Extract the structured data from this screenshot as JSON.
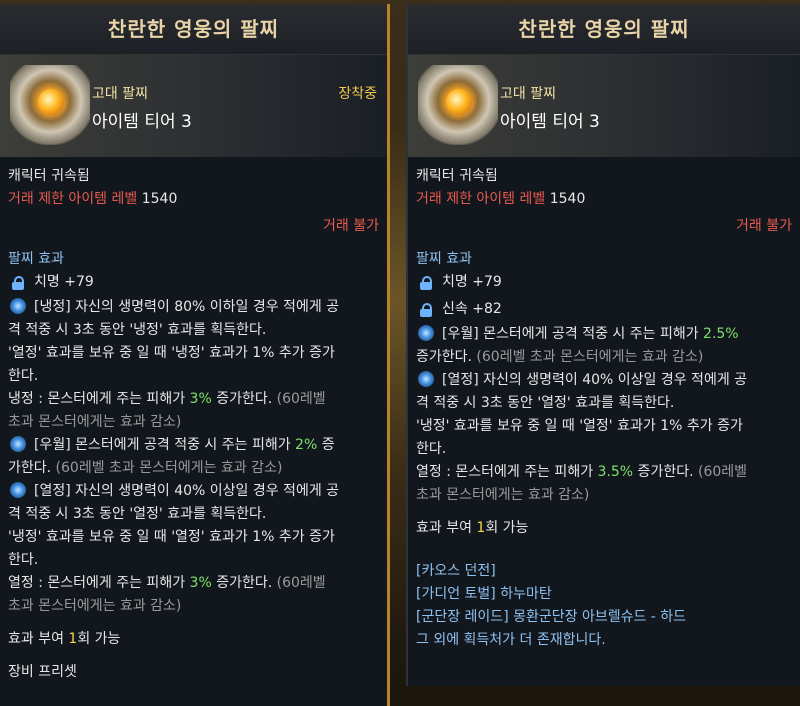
{
  "left": {
    "title": "찬란한 영웅의 팔찌",
    "item_type": "고대 팔찌",
    "tier": "아이템 티어 3",
    "equipped": "장착중",
    "bound": "캐릭터 귀속됨",
    "trade_level_label": "거래 제한 아이템 레벨",
    "trade_level_value": "1540",
    "trade_status": "거래 불가",
    "effects_header": "팔찌 효과",
    "stat1": "치명 +79",
    "e1_l1": "[냉정] 자신의 생명력이 80% 이하일 경우 적에게 공",
    "e1_l2": "격 적중 시 3초 동안 '냉정' 효과를 획득한다.",
    "e1_l3": "'열정' 효과를 보유 중 일 때 '냉정' 효과가 1% 추가 증가",
    "e1_l4": "한다.",
    "e1_l5a": "냉정 : 몬스터에게 주는 피해가 ",
    "e1_l5b": "3%",
    "e1_l5c": " 증가한다. ",
    "e1_l5d": "(60레벨",
    "e1_l6": "초과 몬스터에게는 효과 감소)",
    "e2_l1a": "[우월] 몬스터에게 공격 적중 시 주는 피해가 ",
    "e2_l1b": "2%",
    "e2_l1c": " 증",
    "e2_l2a": "가한다. ",
    "e2_l2b": "(60레벨 초과 몬스터에게는 효과 감소)",
    "e3_l1": "[열정] 자신의 생명력이 40% 이상일 경우 적에게 공",
    "e3_l2": "격 적중 시 3초 동안 '열정' 효과를 획득한다.",
    "e3_l3": "'냉정' 효과를 보유 중 일 때 '열정' 효과가 1% 추가 증가",
    "e3_l4": "한다.",
    "e3_l5a": "열정 : 몬스터에게 주는 피해가 ",
    "e3_l5b": "3%",
    "e3_l5c": " 증가한다. ",
    "e3_l5d": "(60레벨",
    "e3_l6": "초과 몬스터에게는 효과 감소)",
    "grant_a": "효과 부여 ",
    "grant_b": "1",
    "grant_c": "회 가능",
    "preset": "장비 프리셋"
  },
  "right": {
    "title": "찬란한 영웅의 팔찌",
    "item_type": "고대 팔찌",
    "tier": "아이템 티어 3",
    "bound": "캐릭터 귀속됨",
    "trade_level_label": "거래 제한 아이템 레벨",
    "trade_level_value": "1540",
    "trade_status": "거래 불가",
    "effects_header": "팔찌 효과",
    "stat1": "치명 +79",
    "stat2": "신속 +82",
    "e1_l1a": "[우월] 몬스터에게 공격 적중 시 주는 피해가 ",
    "e1_l1b": "2.5%",
    "e1_l2a": "증가한다. ",
    "e1_l2b": "(60레벨 초과 몬스터에게는 효과 감소)",
    "e2_l1": "[열정] 자신의 생명력이 40% 이상일 경우 적에게 공",
    "e2_l2": "격 적중 시 3초 동안 '열정' 효과를 획득한다.",
    "e2_l3": "'냉정' 효과를 보유 중 일 때 '열정' 효과가 1% 추가 증가",
    "e2_l4": "한다.",
    "e2_l5a": "열정 : 몬스터에게 주는 피해가 ",
    "e2_l5b": "3.5%",
    "e2_l5c": " 증가한다. ",
    "e2_l5d": "(60레벨",
    "e2_l6": "초과 몬스터에게는 효과 감소)",
    "grant_a": "효과 부여 ",
    "grant_b": "1",
    "grant_c": "회 가능",
    "sources": [
      "[카오스 던전]",
      "[가디언 토벌] 하누마탄",
      "[군단장 레이드] 몽환군단장 아브렐슈드 - 하드",
      "그 외에 획득처가 더 존재합니다."
    ]
  }
}
